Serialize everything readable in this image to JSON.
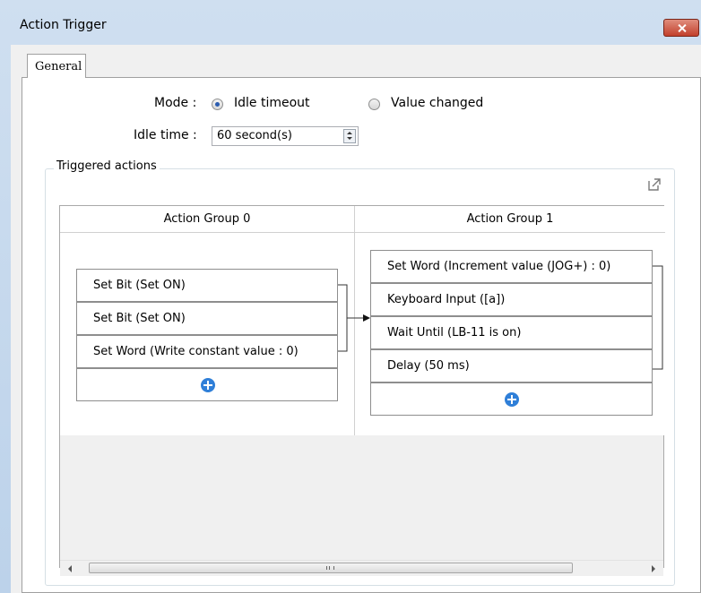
{
  "window": {
    "title": "Action Trigger"
  },
  "tabs": [
    {
      "label": "General",
      "selected": true
    }
  ],
  "mode": {
    "label": "Mode :",
    "options": [
      {
        "label": "Idle timeout",
        "checked": true
      },
      {
        "label": "Value changed",
        "checked": false
      }
    ]
  },
  "idle_time": {
    "label": "Idle time :",
    "value": "60 second(s)"
  },
  "triggered_actions": {
    "legend": "Triggered actions",
    "groups": [
      {
        "title": "Action Group 0",
        "actions": [
          "Set Bit (Set ON)",
          "Set Bit (Set ON)",
          "Set Word (Write constant value : 0)"
        ]
      },
      {
        "title": "Action Group 1",
        "actions": [
          "Set Word (Increment value (JOG+) : 0)",
          "Keyboard Input ([a])",
          "Wait Until (LB-11 is on)",
          "Delay (50 ms)"
        ]
      }
    ]
  },
  "colors": {
    "add_icon": "#2f7fd8",
    "close_button": "#c2402c",
    "window_frame": "#cfdff0"
  },
  "icons": [
    "close-icon",
    "popout-icon",
    "add-icon",
    "spin-up-icon",
    "spin-down-icon",
    "scroll-left-icon",
    "scroll-right-icon"
  ]
}
